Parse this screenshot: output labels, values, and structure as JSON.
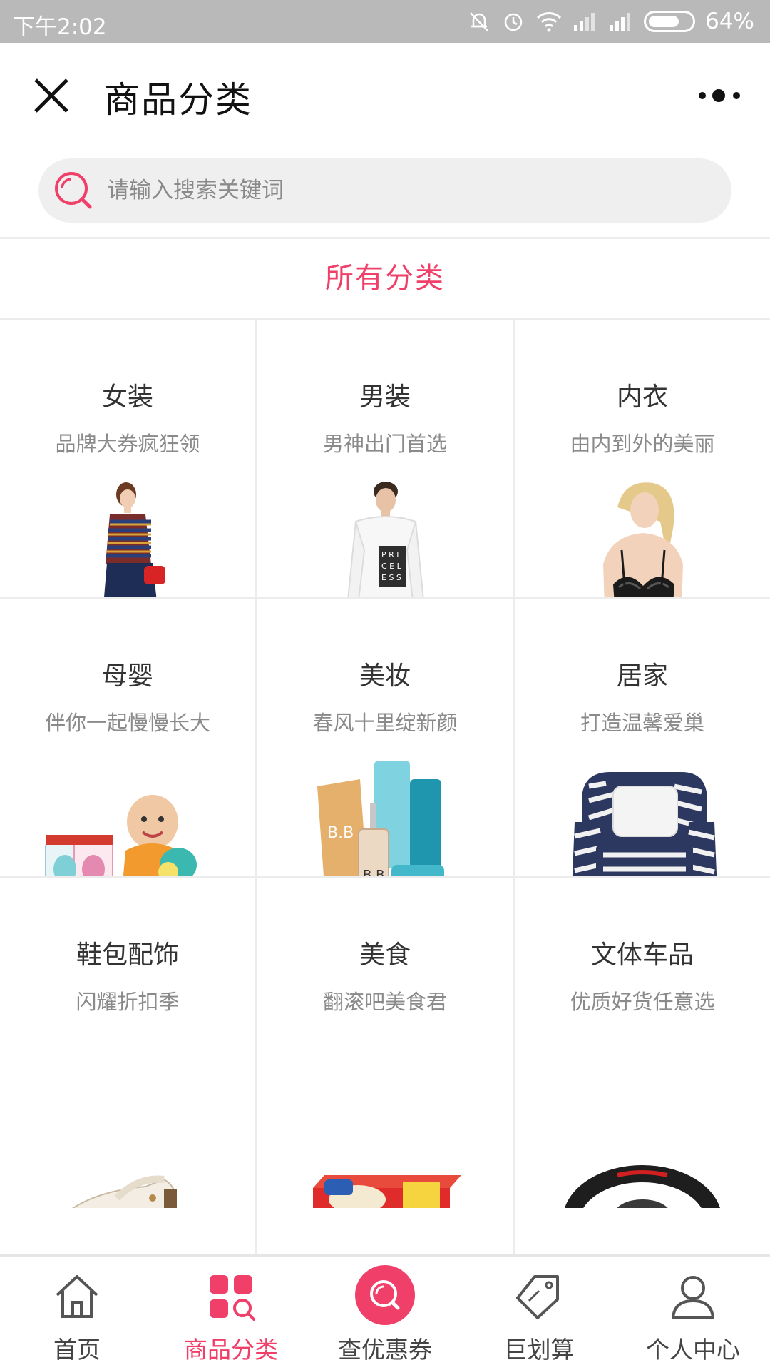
{
  "status_bar": {
    "time": "下午2:02",
    "battery": "64%",
    "battery_level": 0.64
  },
  "header": {
    "title": "商品分类"
  },
  "search": {
    "placeholder": "请输入搜索关键词"
  },
  "section_title": "所有分类",
  "categories": [
    {
      "name": "女装",
      "desc": "品牌大券疯狂领",
      "image": "woman-dress"
    },
    {
      "name": "男装",
      "desc": "男神出门首选",
      "image": "man-sweater"
    },
    {
      "name": "内衣",
      "desc": "由内到外的美丽",
      "image": "lingerie"
    },
    {
      "name": "母婴",
      "desc": "伴你一起慢慢长大",
      "image": "baby-toys"
    },
    {
      "name": "美妆",
      "desc": "春风十里绽新颜",
      "image": "cosmetics"
    },
    {
      "name": "居家",
      "desc": "打造温馨爱巢",
      "image": "armchair"
    },
    {
      "name": "鞋包配饰",
      "desc": "闪耀折扣季",
      "image": "sandal"
    },
    {
      "name": "美食",
      "desc": "翻滚吧美食君",
      "image": "snack-box"
    },
    {
      "name": "文体车品",
      "desc": "优质好货任意选",
      "image": "steering-wheel"
    }
  ],
  "bottom_nav": [
    {
      "label": "首页",
      "icon": "home-icon",
      "active": false
    },
    {
      "label": "商品分类",
      "icon": "category-icon",
      "active": true
    },
    {
      "label": "查优惠券",
      "icon": "coupon-search-icon",
      "active": false
    },
    {
      "label": "巨划算",
      "icon": "tag-icon",
      "active": false
    },
    {
      "label": "个人中心",
      "icon": "user-icon",
      "active": false
    }
  ],
  "colors": {
    "accent": "#f0406a",
    "status_bar": "#b9b9b9"
  }
}
